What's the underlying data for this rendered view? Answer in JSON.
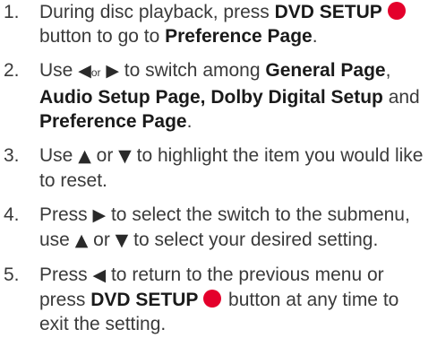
{
  "steps": [
    {
      "num": "1.",
      "t1": "During disc playback, press ",
      "b1": "DVD SETUP",
      "icon": "red-circle-button-icon",
      "t2": " button to go to ",
      "b2": "Preference Page",
      "t3": "."
    },
    {
      "num": "2.",
      "t1": "Use ",
      "left_arrow": "◀",
      "or": "or",
      "right_arrow": "▶",
      "t2": " to switch among ",
      "b1": "General Page",
      "t3": ", ",
      "b2": "Audio Setup Page, Dolby Digital Setup",
      "t4": " and ",
      "b3": "Preference Page",
      "t5": "."
    },
    {
      "num": "3.",
      "t1": "Use ",
      "up_arrow": "▲",
      "t2": " or ",
      "down_arrow": "▼",
      "t3": " to highlight the item you would like to reset."
    },
    {
      "num": "4.",
      "t1": "Press ",
      "right_arrow": "▶",
      "t2": " to select the switch to the submenu, use ",
      "up_arrow": "▲",
      "t3": " or ",
      "down_arrow": "▼",
      "t4": " to select your desired setting."
    },
    {
      "num": "5.",
      "t1": "Press ",
      "left_arrow": "◀",
      "t2": " to return to the previous menu or press ",
      "b1": "DVD SETUP",
      "icon": "red-circle-button-icon",
      "t3": " button at any time to exit the setting."
    }
  ],
  "colors": {
    "text": "#3a3a3a",
    "bold_text": "#1a1a1a",
    "button_dot": "#e4002b"
  }
}
